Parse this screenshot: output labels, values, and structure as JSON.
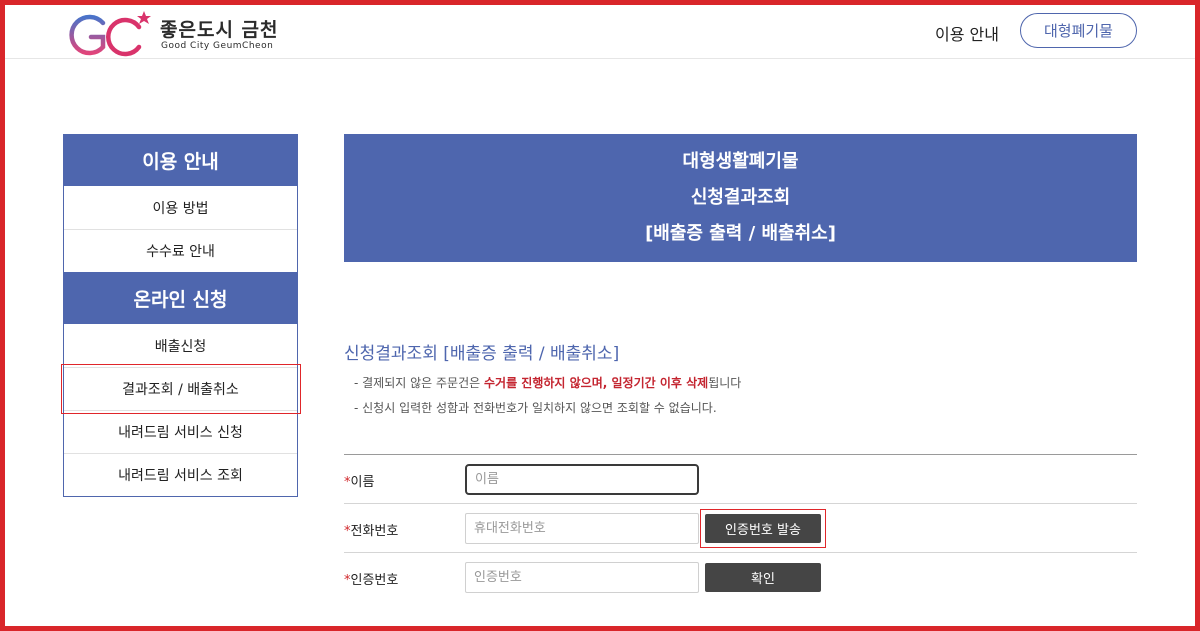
{
  "header": {
    "logo_text_ko": "좋은도시 금천",
    "logo_text_en": "Good City GeumCheon",
    "nav_guide": "이용 안내",
    "nav_button": "대형폐기물"
  },
  "sidebar": {
    "groups": [
      {
        "title": "이용 안내",
        "items": [
          "이용 방법",
          "수수료 안내"
        ]
      },
      {
        "title": "온라인 신청",
        "items": [
          "배출신청",
          "결과조회 / 배출취소",
          "내려드림 서비스 신청",
          "내려드림 서비스 조회"
        ]
      }
    ]
  },
  "banner": {
    "line1": "대형생활폐기물",
    "line2": "신청결과조회",
    "line3": "[배출증 출력 / 배출취소]"
  },
  "section": {
    "title": "신청결과조회 [배출증 출력 / 배출취소]",
    "note1_prefix": "- 결제되지 않은 주문건은 ",
    "note1_red1": "수거를 진행하지 않으며",
    "note1_mid": ", ",
    "note1_red2": "일정기간 이후 삭제",
    "note1_suffix": "됩니다",
    "note2": "- 신청시 입력한 성함과 전화번호가 일치하지 않으면 조회할 수 없습니다."
  },
  "form": {
    "required_mark": "*",
    "name_label": "이름",
    "name_placeholder": "이름",
    "phone_label": "전화번호",
    "phone_placeholder": "휴대전화번호",
    "send_code_button": "인증번호 발송",
    "code_label": "인증번호",
    "code_placeholder": "인증번호",
    "confirm_button": "확인"
  },
  "colors": {
    "primary": "#4e66ae",
    "accent_red": "#c42530",
    "dark_button": "#454545",
    "highlight_frame": "#d9262a"
  }
}
